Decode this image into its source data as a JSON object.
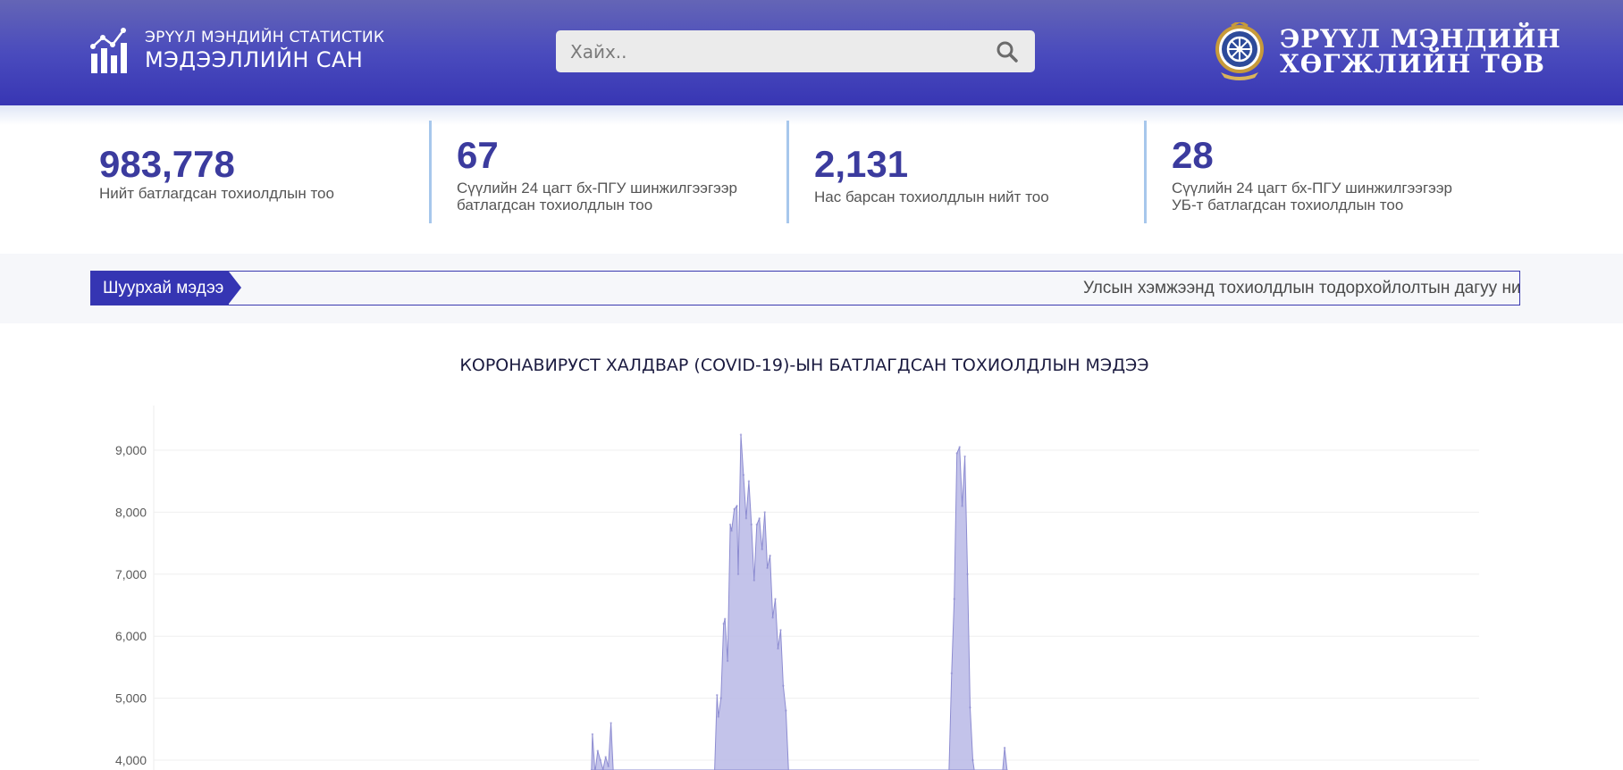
{
  "header": {
    "brand_small": "ЭРҮҮЛ МЭНДИЙН СТАТИСТИК",
    "brand_big": "МЭДЭЭЛЛИЙН САН",
    "search_placeholder": "Хайх..",
    "org_line1": "ЭРҮҮЛ МЭНДИЙН",
    "org_line2": "ХӨГЖЛИЙН ТӨВ",
    "icons": {
      "brand": "bar-chart-trend-icon",
      "search": "magnifier-icon",
      "org": "dharma-wheel-emblem-icon"
    }
  },
  "stats": [
    {
      "value": "983,778",
      "label": "Нийт батлагдсан тохиолдлын тоо"
    },
    {
      "value": "67",
      "label": "Сүүлийн 24 цагт бх-ПГУ шинжилгээгээр батлагдсан тохиолдлын тоо"
    },
    {
      "value": "2,131",
      "label": "Нас барсан тохиолдлын нийт тоо"
    },
    {
      "value": "28",
      "label": "Сүүлийн 24 цагт бх-ПГУ шинжилгээгээр УБ-т батлагдсан тохиолдлын тоо"
    }
  ],
  "news": {
    "label": "Шуурхай мэдээ",
    "text": "Улсын хэмжээнд тохиолдлын тодорхойлолтын дагуу нийт"
  },
  "colors": {
    "accent": "#3535b3",
    "stat_number": "#3b3b9e",
    "area_fill": "#b9b8e6",
    "area_line": "#8d8cd1"
  },
  "chart_data": {
    "type": "area",
    "title": "КОРОНАВИРУСТ ХАЛДВАР (COVID-19)-ЫН БАТЛАГДСАН ТОХИОЛДЛЫН МЭДЭЭ",
    "xlabel": "",
    "ylabel": "",
    "y_ticks": [
      "4,000",
      "5,000",
      "6,000",
      "7,000",
      "8,000",
      "9,000"
    ],
    "ylim": [
      3850,
      9700
    ],
    "grid": true,
    "legend": "none",
    "x_index_range": [
      0,
      1000
    ],
    "peaks": [
      [
        330,
        3600
      ],
      [
        331,
        4420
      ],
      [
        333,
        3800
      ],
      [
        335,
        4150
      ],
      [
        337,
        4000
      ],
      [
        339,
        3850
      ],
      [
        341,
        4050
      ],
      [
        343,
        3900
      ],
      [
        345,
        4600
      ],
      [
        347,
        3700
      ],
      [
        423,
        3700
      ],
      [
        425,
        5050
      ],
      [
        426,
        4700
      ],
      [
        428,
        5000
      ],
      [
        430,
        6200
      ],
      [
        431,
        6280
      ],
      [
        433,
        5600
      ],
      [
        435,
        7800
      ],
      [
        436,
        7700
      ],
      [
        438,
        8050
      ],
      [
        440,
        8100
      ],
      [
        441,
        7000
      ],
      [
        443,
        9250
      ],
      [
        445,
        8600
      ],
      [
        447,
        7900
      ],
      [
        449,
        8500
      ],
      [
        451,
        7800
      ],
      [
        453,
        6900
      ],
      [
        455,
        7800
      ],
      [
        457,
        7900
      ],
      [
        459,
        7400
      ],
      [
        461,
        8000
      ],
      [
        463,
        7100
      ],
      [
        465,
        7300
      ],
      [
        467,
        6300
      ],
      [
        469,
        6600
      ],
      [
        471,
        5800
      ],
      [
        473,
        6100
      ],
      [
        475,
        5200
      ],
      [
        477,
        4800
      ],
      [
        479,
        3800
      ],
      [
        600,
        3800
      ],
      [
        602,
        5400
      ],
      [
        604,
        6600
      ],
      [
        606,
        8950
      ],
      [
        608,
        9050
      ],
      [
        610,
        8100
      ],
      [
        612,
        8900
      ],
      [
        614,
        7000
      ],
      [
        616,
        4850
      ],
      [
        618,
        4000
      ],
      [
        620,
        3700
      ],
      [
        640,
        3700
      ],
      [
        642,
        4200
      ],
      [
        644,
        3800
      ]
    ]
  }
}
